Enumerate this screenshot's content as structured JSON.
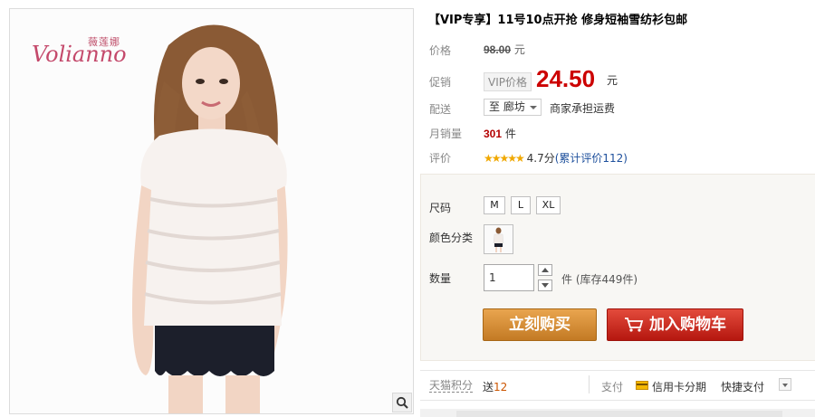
{
  "product": {
    "title": "【VIP专享】11号10点开抢 修身短袖雪纺衫包邮"
  },
  "brand": {
    "name_cn": "薇莲娜",
    "name_en": "Volianno"
  },
  "price": {
    "label": "价格",
    "original": "98.00",
    "unit": "元"
  },
  "promo": {
    "label": "促销",
    "tag": "VIP价格",
    "price": "24.50",
    "unit": "元"
  },
  "shipping": {
    "label": "配送",
    "destination": "至 廊坊",
    "note": "商家承担运费"
  },
  "sales": {
    "label": "月销量",
    "count": "301",
    "unit": "件"
  },
  "rating": {
    "label": "评价",
    "stars": "★★★★★",
    "score": "4.7分",
    "review_link": "(累计评价112)"
  },
  "options": {
    "size_label": "尺码",
    "sizes": [
      "M",
      "L",
      "XL"
    ],
    "color_label": "颜色分类"
  },
  "quantity": {
    "label": "数量",
    "value": "1",
    "stock": "件 (库存449件)"
  },
  "actions": {
    "buy_now": "立刻购买",
    "add_to_cart": "加入购物车"
  },
  "footer": {
    "points_label": "天猫积分",
    "points_prefix": "送",
    "points_value": "12",
    "pay_label": "支付",
    "pay_card": "信用卡分期",
    "pay_fast": "快捷支付"
  },
  "colors": {
    "price_red": "#cc0000",
    "buy_orange": "#d98c35",
    "cart_red": "#c8251a",
    "star_gold": "#f0a800",
    "link_blue": "#1d4f9c"
  }
}
